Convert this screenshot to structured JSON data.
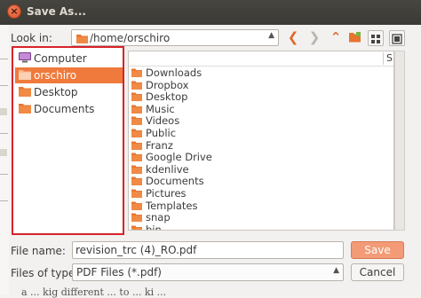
{
  "window": {
    "title": "Save As..."
  },
  "toolbar": {
    "look_in_label": "Look in:",
    "path": "/home/orschiro",
    "back_icon": "chevron-left-icon",
    "forward_icon": "chevron-right-icon",
    "up_icon": "chevron-up-icon",
    "new_folder_icon": "new-folder-icon",
    "detail_view_icon": "detail-view-icon",
    "list_view_icon": "list-view-icon"
  },
  "sidebar": {
    "items": [
      {
        "label": "Computer",
        "icon": "computer-icon",
        "selected": false
      },
      {
        "label": "orschiro",
        "icon": "folder-icon",
        "selected": true
      },
      {
        "label": "Desktop",
        "icon": "folder-icon",
        "selected": false
      },
      {
        "label": "Documents",
        "icon": "folder-icon",
        "selected": false
      }
    ],
    "highlight_color": "#d8232a"
  },
  "filelist": {
    "column_header": "S",
    "items": [
      "Downloads",
      "Dropbox",
      "Desktop",
      "Music",
      "Videos",
      "Public",
      "Franz",
      "Google Drive",
      "kdenlive",
      "Documents",
      "Pictures",
      "Templates",
      "snap",
      "bin"
    ]
  },
  "footer": {
    "filename_label": "File name:",
    "filename_value": "revision_trc (4)_RO.pdf",
    "filetype_label": "Files of type:",
    "filetype_value": "PDF Files (*.pdf)",
    "save_label": "Save",
    "cancel_label": "Cancel"
  },
  "background": {
    "partial_text": "a ... kig different ... to ... ki ..."
  },
  "colors": {
    "accent": "#ef7a3c",
    "folder": "#e8742e",
    "titlebar": "#3c3b37"
  }
}
